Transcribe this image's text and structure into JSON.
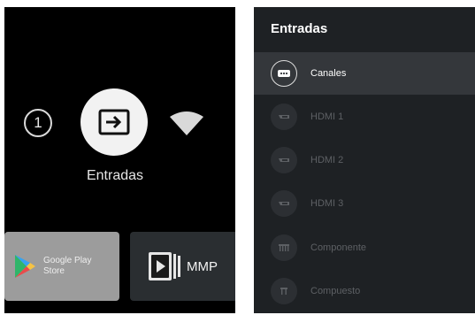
{
  "home": {
    "notification_count": "1",
    "inputs_label": "Entradas",
    "apps": [
      {
        "label_line1": "Google Play",
        "label_line2": "Store"
      },
      {
        "label": "MMP"
      }
    ]
  },
  "inputs_panel": {
    "title": "Entradas",
    "items": [
      {
        "label": "Canales",
        "icon": "tv-channels-icon",
        "selected": true
      },
      {
        "label": "HDMI 1",
        "icon": "hdmi-icon"
      },
      {
        "label": "HDMI 2",
        "icon": "hdmi-icon"
      },
      {
        "label": "HDMI 3",
        "icon": "hdmi-icon"
      },
      {
        "label": "Componente",
        "icon": "component-icon"
      },
      {
        "label": "Compuesto",
        "icon": "composite-icon"
      }
    ]
  },
  "colors": {
    "panel_bg": "#1e2124",
    "selected_row": "#34373b",
    "disabled_text": "#5d6064"
  }
}
